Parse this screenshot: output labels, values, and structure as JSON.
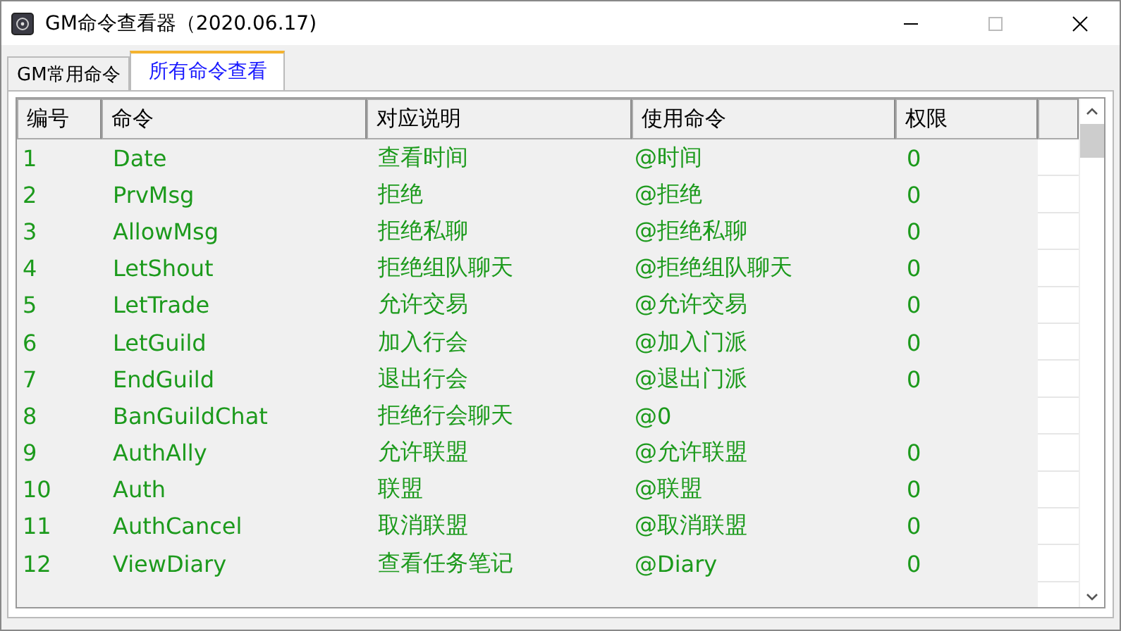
{
  "window": {
    "title": "GM命令查看器（2020.06.17)"
  },
  "tabs": [
    {
      "label": "GM常用命令",
      "selected": false
    },
    {
      "label": "所有命令查看",
      "selected": true
    }
  ],
  "table": {
    "columns": [
      "编号",
      "命令",
      "对应说明",
      "使用命令",
      "权限"
    ],
    "rows": [
      [
        "1",
        "Date",
        "查看时间",
        "@时间",
        "0"
      ],
      [
        "2",
        "PrvMsg",
        "拒绝",
        "@拒绝",
        "0"
      ],
      [
        "3",
        "AllowMsg",
        "拒绝私聊",
        "@拒绝私聊",
        "0"
      ],
      [
        "4",
        "LetShout",
        "拒绝组队聊天",
        "@拒绝组队聊天",
        "0"
      ],
      [
        "5",
        "LetTrade",
        "允许交易",
        "@允许交易",
        "0"
      ],
      [
        "6",
        "LetGuild",
        "加入行会",
        "@加入门派",
        "0"
      ],
      [
        "7",
        "EndGuild",
        "退出行会",
        "@退出门派",
        "0"
      ],
      [
        "8",
        "BanGuildChat",
        "拒绝行会聊天",
        "@0",
        ""
      ],
      [
        "9",
        "AuthAlly",
        "允许联盟",
        "@允许联盟",
        "0"
      ],
      [
        "10",
        "Auth",
        "联盟",
        "@联盟",
        "0"
      ],
      [
        "11",
        "AuthCancel",
        "取消联盟",
        "@取消联盟",
        "0"
      ],
      [
        "12",
        "ViewDiary",
        "查看任务笔记",
        "@Diary",
        "0"
      ]
    ]
  }
}
